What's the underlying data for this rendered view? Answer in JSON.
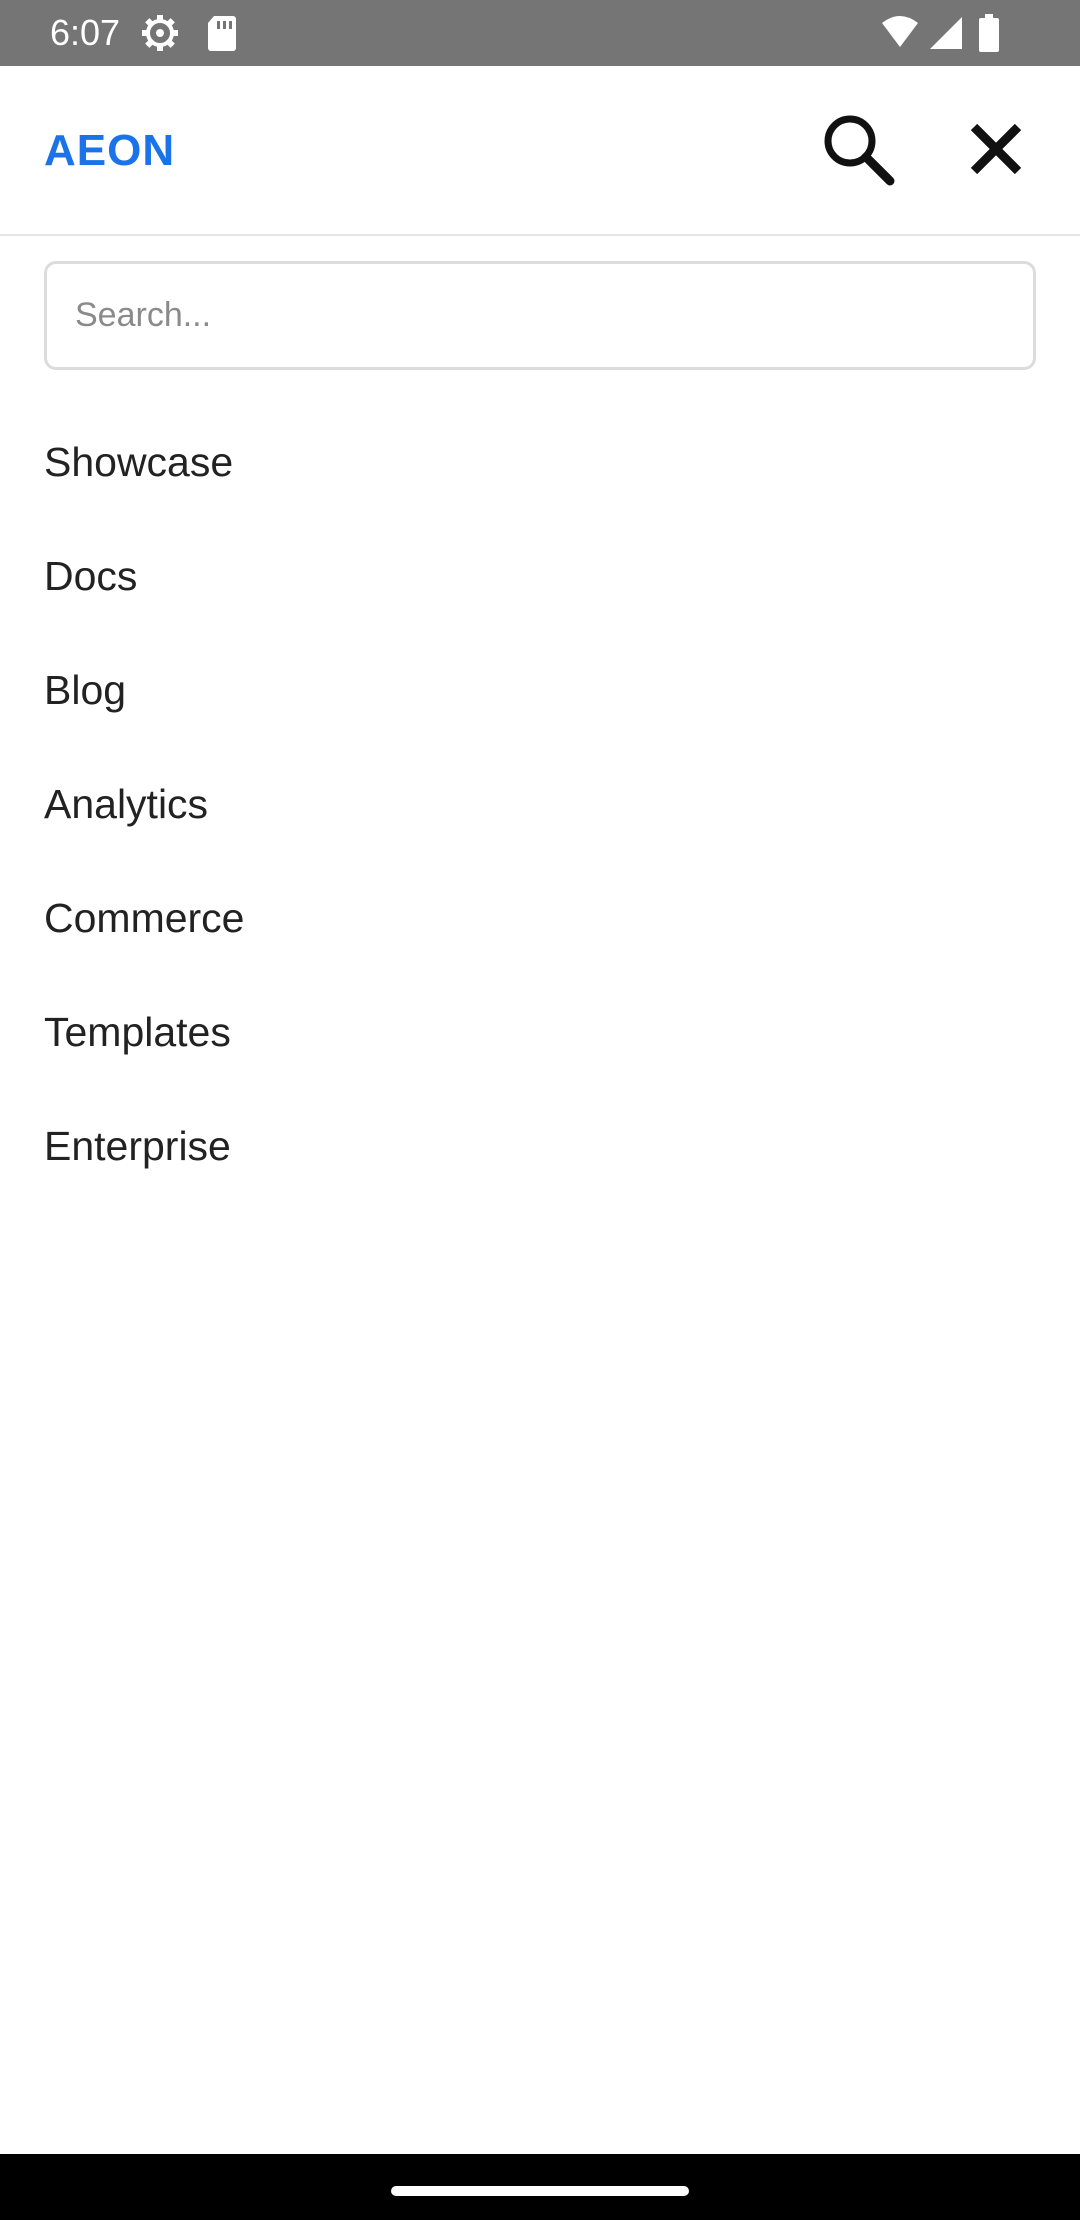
{
  "status_bar": {
    "time": "6:07",
    "icons": [
      "settings-icon",
      "sd-card-icon",
      "wifi-icon",
      "signal-icon",
      "battery-icon"
    ]
  },
  "header": {
    "brand": "AEON",
    "brand_color": "#1a73e8",
    "search_icon": "search-icon",
    "close_icon": "close-icon"
  },
  "search": {
    "placeholder": "Search...",
    "value": ""
  },
  "menu": {
    "items": [
      {
        "label": "Showcase"
      },
      {
        "label": "Docs"
      },
      {
        "label": "Blog"
      },
      {
        "label": "Analytics"
      },
      {
        "label": "Commerce"
      },
      {
        "label": "Templates"
      },
      {
        "label": "Enterprise"
      }
    ]
  }
}
